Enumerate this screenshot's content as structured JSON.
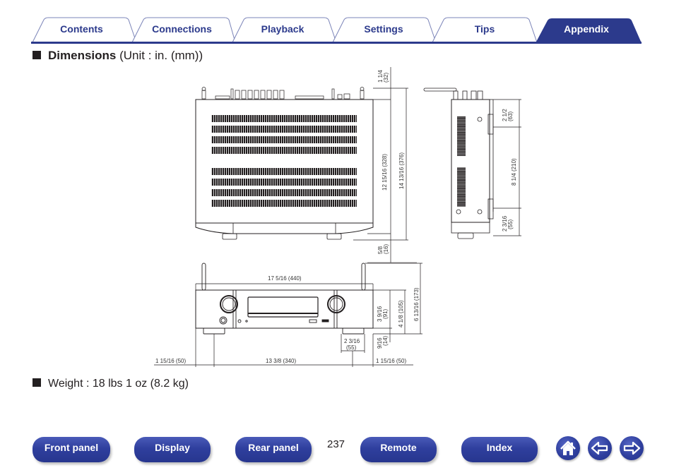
{
  "tabs": [
    {
      "label": "Contents",
      "active": false
    },
    {
      "label": "Connections",
      "active": false
    },
    {
      "label": "Playback",
      "active": false
    },
    {
      "label": "Settings",
      "active": false
    },
    {
      "label": "Tips",
      "active": false
    },
    {
      "label": "Appendix",
      "active": true
    }
  ],
  "colors": {
    "brand": "#2c3a8c",
    "active_tab": "#2c3a8c",
    "text": "#231f20"
  },
  "dimensions_heading": {
    "bold": "Dimensions",
    "normal": " (Unit : in. (mm))"
  },
  "top_view": {
    "dims": {
      "top_offset": [
        "1 1/4",
        "(32)"
      ],
      "depth_body": "12 15/16 (328)",
      "depth_total": "14 13/16 (376)",
      "bottom_offset": [
        "5/8",
        "(16)"
      ]
    }
  },
  "side_view": {
    "dims": {
      "upper": [
        "2 1/2",
        "(63)"
      ],
      "middle": "8 1/4 (210)",
      "lower": [
        "2 3/16",
        "(55)"
      ]
    }
  },
  "front_view": {
    "dims": {
      "width": "17 5/16 (440)",
      "body_height": [
        "3 9/16",
        "(91)"
      ],
      "height_with_feet": "4 1/8 (105)",
      "height_with_antenna": "6 13/16 (173)",
      "foot_height": [
        "9/16",
        "(14)"
      ],
      "foot_width": [
        "2 3/16",
        "(55)"
      ],
      "left_offset": "1 15/16 (50)",
      "foot_span": "13 3/8 (340)",
      "right_offset": "1 15/16 (50)"
    }
  },
  "weight_heading": {
    "text": "Weight : 18 lbs 1 oz (8.2 kg)"
  },
  "bottom_nav": {
    "buttons": [
      "Front panel",
      "Display",
      "Rear panel",
      "Remote",
      "Index"
    ],
    "page_number": "237",
    "icons": [
      "home-icon",
      "back-arrow-icon",
      "forward-arrow-icon"
    ]
  }
}
